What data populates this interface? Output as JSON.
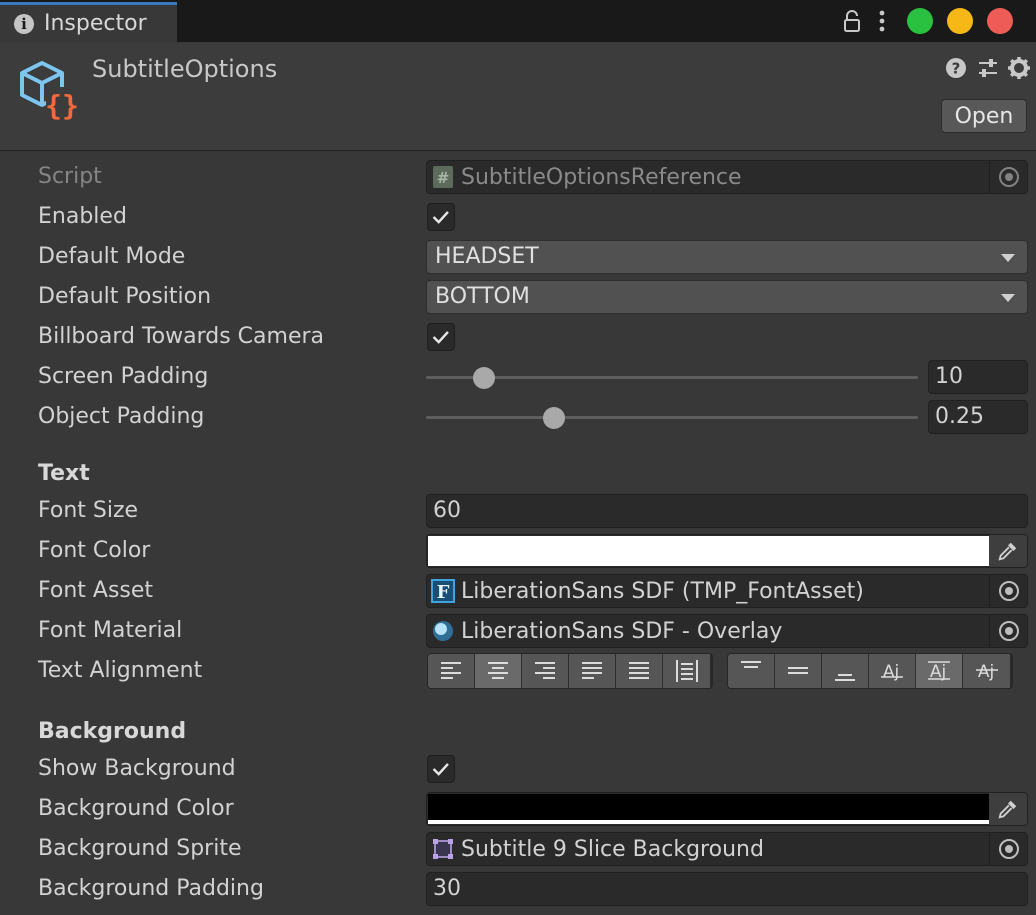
{
  "window": {
    "tab_label": "Inspector",
    "icons": [
      "info-icon",
      "lock-icon",
      "more-icon"
    ],
    "controls": {
      "close": "#ed5c56",
      "minimize": "#f6b816",
      "maximize": "#29c13f"
    }
  },
  "header": {
    "title": "SubtitleOptions",
    "open_label": "Open",
    "icons": [
      "help-icon",
      "preset-icon",
      "settings-icon"
    ]
  },
  "fields": {
    "script": {
      "label": "Script",
      "value": "SubtitleOptionsReference"
    },
    "enabled": {
      "label": "Enabled",
      "checked": true
    },
    "default_mode": {
      "label": "Default Mode",
      "value": "HEADSET"
    },
    "default_position": {
      "label": "Default Position",
      "value": "BOTTOM"
    },
    "billboard": {
      "label": "Billboard Towards Camera",
      "checked": true
    },
    "screen_padding": {
      "label": "Screen Padding",
      "value": "10",
      "fraction": 0.117
    },
    "object_padding": {
      "label": "Object Padding",
      "value": "0.25",
      "fraction": 0.26
    }
  },
  "text_section": {
    "heading": "Text",
    "font_size": {
      "label": "Font Size",
      "value": "60"
    },
    "font_color": {
      "label": "Font Color",
      "color": "#ffffff"
    },
    "font_asset": {
      "label": "Font Asset",
      "value": "LiberationSans SDF (TMP_FontAsset)"
    },
    "font_material": {
      "label": "Font Material",
      "value": "LiberationSans SDF - Overlay"
    },
    "text_alignment": {
      "label": "Text Alignment",
      "horizontal": [
        "left",
        "center",
        "right",
        "justified",
        "flush",
        "geometry-center"
      ],
      "horizontal_selected": "center",
      "vertical": [
        "top",
        "middle",
        "bottom",
        "baseline",
        "midline",
        "capline"
      ],
      "vertical_selected": "midline"
    }
  },
  "background_section": {
    "heading": "Background",
    "show_background": {
      "label": "Show Background",
      "checked": true
    },
    "background_color": {
      "label": "Background Color",
      "color": "#000000"
    },
    "background_sprite": {
      "label": "Background Sprite",
      "value": "Subtitle 9 Slice Background"
    },
    "background_padding": {
      "label": "Background Padding",
      "value": "30"
    }
  }
}
